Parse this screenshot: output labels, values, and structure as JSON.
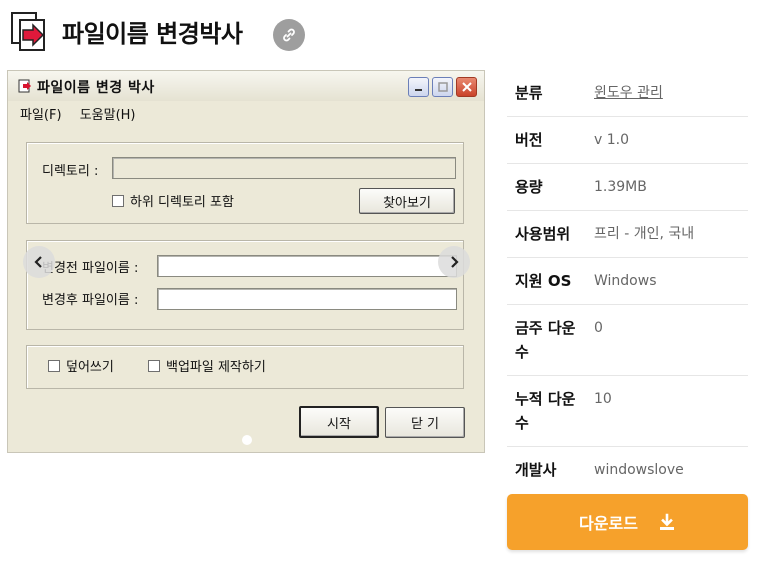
{
  "header": {
    "title": "파일이름 변경박사",
    "app_icon": "document-arrow-icon",
    "link_icon": "link-icon"
  },
  "screenshot": {
    "window_title": "파일이름 변경 박사",
    "menu": [
      "파일(F)",
      "도움말(H)"
    ],
    "directory_label": "디렉토리 :",
    "subdir_checkbox_label": "하위 디렉토리 포함",
    "browse_button": "찾아보기",
    "before_label": "변경전 파일이름 :",
    "after_label": "변경후 파일이름 :",
    "overwrite_label": "덮어쓰기",
    "backup_label": "백업파일 제작하기",
    "start_button": "시작",
    "close_button": "닫 기"
  },
  "info": [
    {
      "key": "분류",
      "value": "윈도우 관리",
      "link": true
    },
    {
      "key": "버전",
      "value": "v 1.0"
    },
    {
      "key": "용량",
      "value": "1.39MB"
    },
    {
      "key": "사용범위",
      "value": "프리 - 개인, 국내"
    },
    {
      "key": "지원 OS",
      "value": "Windows"
    },
    {
      "key": "금주 다운수",
      "value": "0"
    },
    {
      "key": "누적 다운수",
      "value": "10"
    },
    {
      "key": "개발사",
      "value": "windowslove"
    }
  ],
  "download": {
    "label": "다운로드",
    "icon": "download-icon"
  },
  "colors": {
    "accent": "#f6a12b",
    "link_bg": "#9e9e9e"
  }
}
